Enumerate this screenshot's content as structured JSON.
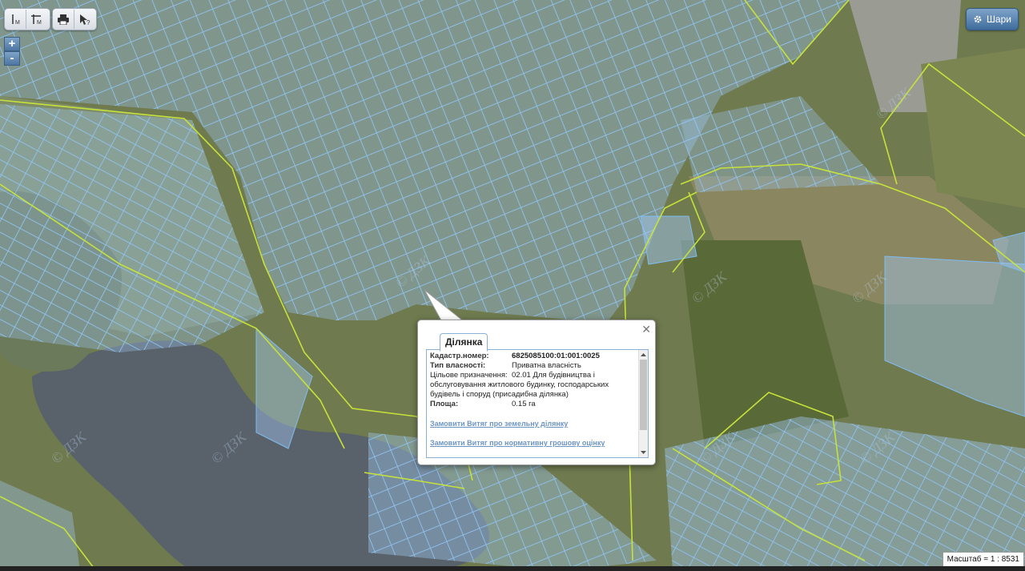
{
  "toolbar": {
    "measure_length_label": "|м",
    "measure_area_label": "м²",
    "print_icon": "printer-icon",
    "identify_icon": "cursor-question-icon"
  },
  "zoom": {
    "in_label": "+",
    "out_label": "-"
  },
  "layers_button": {
    "label": "Шари",
    "icon": "gear-icon"
  },
  "popup": {
    "tab_label": "Ділянка",
    "fields": [
      {
        "label": "Кадастр.номер:",
        "value": "6825085100:01:001:0025"
      },
      {
        "label": "Тип власності:",
        "value": "Приватна власність"
      },
      {
        "label": "Цільове призначення:",
        "value": "02.01 Для будівництва і обслуговування житлового будинку, господарських будівель і споруд (присадибна ділянка)"
      },
      {
        "label": "Площа:",
        "value": "0.15 га"
      }
    ],
    "links": [
      "Замовити Витяг про земельну ділянку",
      "Замовити Витяг про нормативну грошову оцінку"
    ]
  },
  "scale": {
    "label": "Масштаб = 1 : 8531"
  },
  "watermark": "© ДЗК",
  "colors": {
    "parcel_fill": "#9fc6ef",
    "parcel_stroke": "#7fbcf2",
    "boundary": "#c6e23a",
    "water": "#59626a",
    "field": "#7f8a5d"
  }
}
